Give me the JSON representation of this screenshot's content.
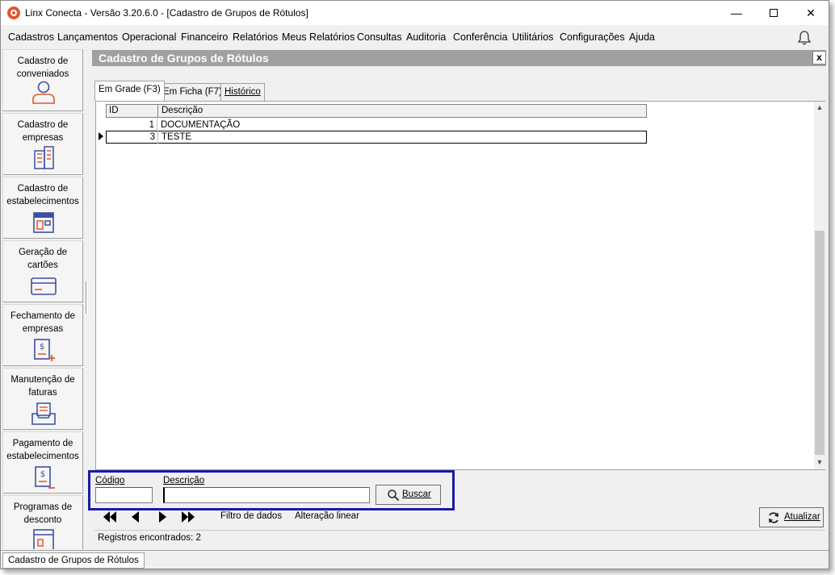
{
  "window": {
    "title": "Linx Conecta - Versão 3.20.6.0 - [Cadastro de Grupos de Rótulos]",
    "minimize": "—",
    "close": "✕"
  },
  "menu": {
    "items": [
      "Cadastros",
      "Lançamentos",
      "Operacional",
      "Financeiro",
      "Relatórios",
      "Meus Relatórios",
      "Consultas",
      "Auditoria",
      "Conferência",
      "Utilitários",
      "Configurações",
      "Ajuda"
    ]
  },
  "sidebar": {
    "items": [
      {
        "label": "Cadastro de conveniados",
        "icon": "person-icon"
      },
      {
        "label": "Cadastro de empresas",
        "icon": "building-icon"
      },
      {
        "label": "Cadastro de estabelecimentos",
        "icon": "store-icon"
      },
      {
        "label": "Geração de cartões",
        "icon": "card-icon"
      },
      {
        "label": "Fechamento de empresas",
        "icon": "invoice-close-icon"
      },
      {
        "label": "Manutenção de faturas",
        "icon": "tray-icon"
      },
      {
        "label": "Pagamento de estabelecimentos",
        "icon": "payment-icon"
      },
      {
        "label": "Programas de desconto",
        "icon": "discount-icon"
      }
    ]
  },
  "form": {
    "title": "Cadastro de Grupos de Rótulos",
    "close_label": "x",
    "tabs": [
      "Em Grade (F3)",
      "Em Ficha (F7)",
      "Histórico"
    ],
    "active_tab": "Em Grade (F3)"
  },
  "grid": {
    "columns": [
      "ID",
      "Descrição"
    ],
    "rows": [
      {
        "id": "1",
        "descricao": "DOCUMENTAÇÃO"
      },
      {
        "id": "3",
        "descricao": "TESTE"
      }
    ],
    "selected_row": 1
  },
  "filter": {
    "codigo_label": "Código",
    "codigo_value": "",
    "descricao_label": "Descrição",
    "descricao_value": "",
    "buscar_label": "Buscar"
  },
  "nav": {
    "filtro_label": "Filtro de dados",
    "alteracao_label": "Alteração linear",
    "atualizar_label": "Atualizar"
  },
  "status": {
    "records": "Registros encontrados: 2"
  },
  "taskbar": {
    "open_form": "Cadastro de Grupos de Rótulos"
  },
  "colors": {
    "highlight_border": "#1a1aa6",
    "form_header": "#a0a0a0",
    "sidebar_icon": "#3d4fa1",
    "accent_orange": "#e4572e"
  }
}
